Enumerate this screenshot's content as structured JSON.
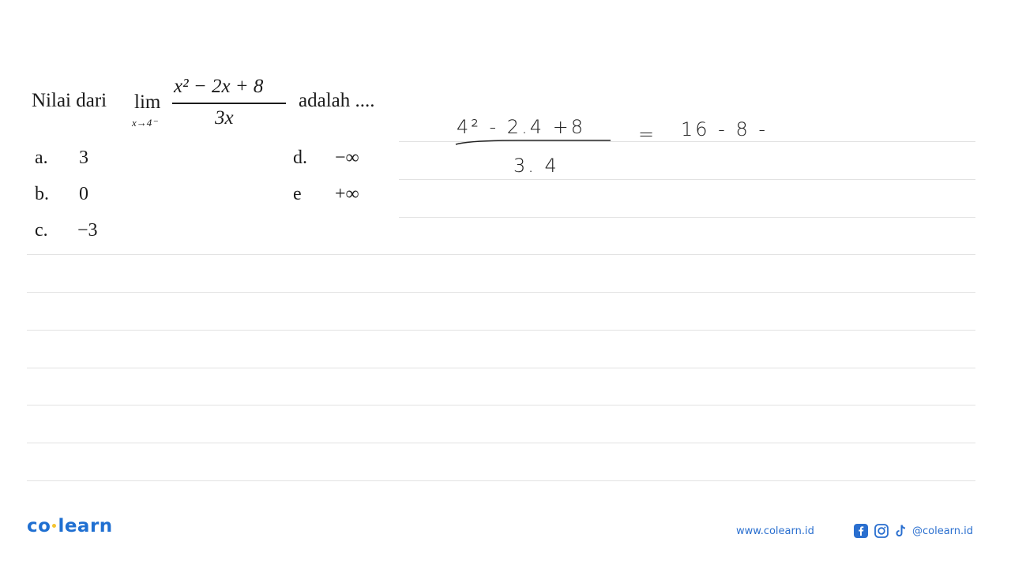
{
  "question": {
    "prefix": "Nilai dari",
    "lim": "lim",
    "lim_sub": "x→4⁻",
    "numerator": "x² − 2x + 8",
    "denominator": "3x",
    "suffix": "adalah ...."
  },
  "options": [
    {
      "label": "a.",
      "value": "3"
    },
    {
      "label": "b.",
      "value": "0"
    },
    {
      "label": "c.",
      "value": "−3"
    },
    {
      "label": "d.",
      "value": "−∞"
    },
    {
      "label": "e",
      "value": "+∞"
    }
  ],
  "handwriting": {
    "numerator": "4² - 2.4 +8",
    "denominator": "3. 4",
    "equals": "=",
    "result": "16 - 8 -"
  },
  "footer": {
    "logo_left": "co",
    "logo_right": "learn",
    "website": "www.colearn.id",
    "social_handle": "@colearn.id",
    "brand_color": "#1f6fd1"
  }
}
